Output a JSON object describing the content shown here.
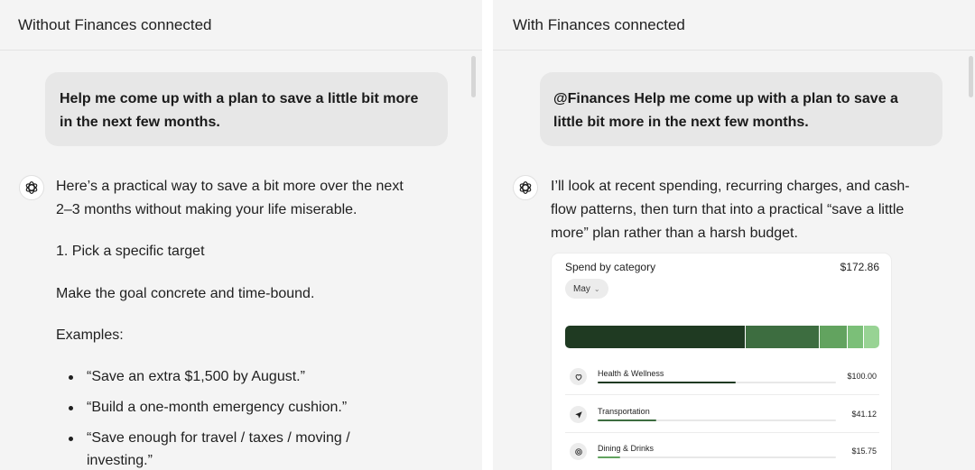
{
  "left": {
    "header": "Without Finances connected",
    "user_message": "Help me come up with a plan to save a little bit more in the next few months.",
    "assistant": {
      "intro": "Here’s a practical way to save a bit more over the next 2–3 months without making your life miserable.",
      "step": "1. Pick a specific target",
      "goal": "Make the goal concrete and time-bound.",
      "examples_heading": "Examples:",
      "examples": [
        "“Save an extra $1,500 by August.”",
        "“Build a one-month emergency cushion.”",
        "“Save enough for travel / taxes / moving / investing.”"
      ]
    }
  },
  "right": {
    "header": "With Finances connected",
    "user_message": "@Finances Help me come up with a plan to save a little bit more in the next few months.",
    "assistant": {
      "intro": "I’ll look at recent spending, recurring charges, and cash-flow patterns, then turn that into a practical “save a little more” plan rather than a harsh budget."
    },
    "card": {
      "title": "Spend by category",
      "total": "$172.86",
      "month": "May",
      "segments": [
        {
          "share": 0.575,
          "color": "#1f3a22"
        },
        {
          "share": 0.235,
          "color": "#3d6d40"
        },
        {
          "share": 0.09,
          "color": "#62a35f"
        },
        {
          "share": 0.05,
          "color": "#7bbf78"
        },
        {
          "share": 0.05,
          "color": "#98d394"
        }
      ],
      "categories": [
        {
          "label": "Health & Wellness",
          "amount": "$100.00",
          "fraction": 0.58,
          "color": "#1f3a22",
          "icon": "heart-icon"
        },
        {
          "label": "Transportation",
          "amount": "$41.12",
          "fraction": 0.245,
          "color": "#3d6d40",
          "icon": "navigation-arrow-icon"
        },
        {
          "label": "Dining & Drinks",
          "amount": "$15.75",
          "fraction": 0.095,
          "color": "#62a35f",
          "icon": "dining-icon"
        }
      ]
    }
  }
}
